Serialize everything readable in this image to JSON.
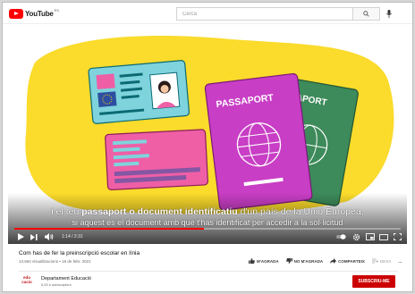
{
  "header": {
    "logo_text": "YouTube",
    "logo_sup": "ES",
    "search_placeholder": "Cerca"
  },
  "video": {
    "illustration": {
      "passport_label_front": "PASSAPORT",
      "passport_label_back": "SSAPORT"
    },
    "subtitle_line1_pre": "i el teu ",
    "subtitle_line1_bold": "passaport o document identificatiu",
    "subtitle_line1_post": " d'un país de la Unió Europea,",
    "subtitle_line2": "si aquest és el document amb què t'has identificat per accedir a la sol·licitud",
    "time": "1:14 / 2:31",
    "progress": 0.49
  },
  "info": {
    "title": "Com has de fer la preinscripció escolar en línia",
    "meta": "13.664 visualitzacions • 16 de febr. 2021",
    "like_label": "M'AGRADA",
    "dislike_label": "NO M'AGRADA",
    "share_label": "COMPARTEIX",
    "save_label": "DESA",
    "more_label": "..."
  },
  "channel": {
    "logo_line1": "edu",
    "logo_line2": "cacio",
    "name": "Departament Educació",
    "subscribers": "5,63 k subscriptors",
    "subscribe_label": "SUBSCRIU-ME"
  },
  "colors": {
    "brand_red": "#ff0000",
    "subscribe_red": "#cc0000",
    "illustration_yellow": "#fbdb2b",
    "passport_magenta": "#c83ec5",
    "passport_green": "#3d8a5a",
    "id_card_cyan": "#7fd3dc",
    "id_card_pink": "#ef5fa6"
  }
}
